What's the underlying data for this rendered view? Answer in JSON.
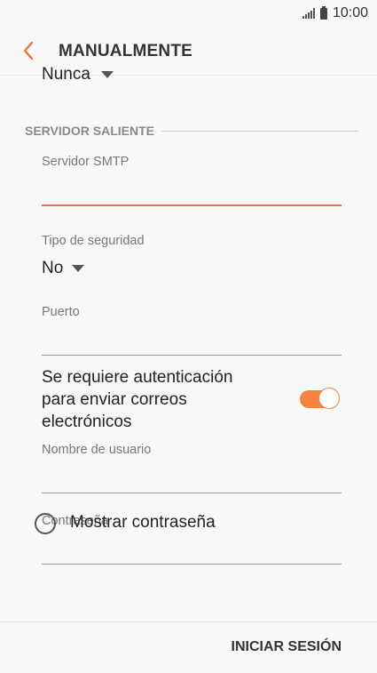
{
  "status": {
    "time": "10:00"
  },
  "header": {
    "title": "MANUALMENTE"
  },
  "partial_select": {
    "value": "Nunca"
  },
  "outgoing": {
    "section_title": "SERVIDOR SALIENTE",
    "smtp_label": "Servidor SMTP",
    "smtp_value": "",
    "security_label": "Tipo de seguridad",
    "security_value": "No",
    "port_label": "Puerto",
    "port_value": ""
  },
  "auth": {
    "label": "Se requiere autenticación para enviar correos electrónicos",
    "enabled": true,
    "username_label": "Nombre de usuario",
    "username_value": "",
    "password_label": "Contraseña",
    "password_value": "",
    "show_password_label": "Mostrar contraseña"
  },
  "footer": {
    "signin_label": "INICIAR SESIÓN"
  },
  "colors": {
    "accent": "#f0703c",
    "toggle": "#f5843f"
  }
}
